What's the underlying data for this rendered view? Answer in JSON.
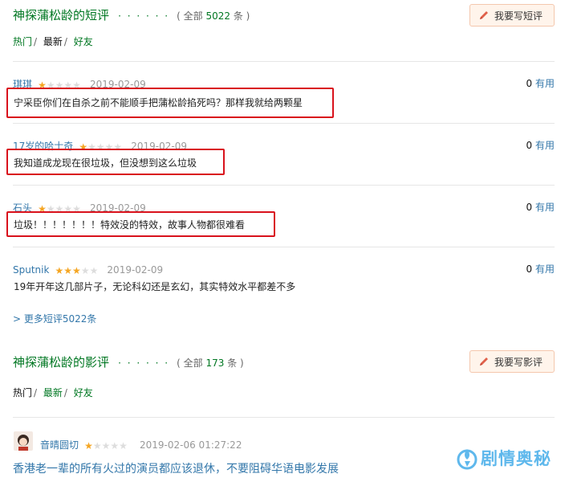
{
  "short_reviews": {
    "title": "神探蒲松龄的短评",
    "dots": "· · · · · ·",
    "count_prefix": "( 全部 ",
    "count": "5022",
    "count_suffix": " 条 )",
    "write_button": "我要写短评",
    "tabs": [
      "热门",
      "最新",
      "好友"
    ],
    "reviews": [
      {
        "user": "琪琪",
        "rating": 1,
        "date": "2019-02-09",
        "votes": "0",
        "votes_label": "有用",
        "text": "宁采臣你们在自杀之前不能顺手把蒲松龄掐死吗？那样我就给两颗星"
      },
      {
        "user": "17岁的哈士奇",
        "rating": 1,
        "date": "2019-02-09",
        "votes": "0",
        "votes_label": "有用",
        "text": "我知道成龙现在很垃圾，但没想到这么垃圾"
      },
      {
        "user": "石头",
        "rating": 1,
        "date": "2019-02-09",
        "votes": "0",
        "votes_label": "有用",
        "text": "垃圾！！！！！！！特效没的特效，故事人物都很难看"
      },
      {
        "user": "Sputnik",
        "rating": 3,
        "date": "2019-02-09",
        "votes": "0",
        "votes_label": "有用",
        "text": "19年开年这几部片子，无论科幻还是玄幻，其实特效水平都差不多"
      }
    ],
    "more_link": "> 更多短评5022条"
  },
  "film_reviews": {
    "title": "神探蒲松龄的影评",
    "dots": "· · · · · ·",
    "count_prefix": "( 全部 ",
    "count": "173",
    "count_suffix": " 条 )",
    "write_button": "我要写影评",
    "tabs": [
      "热门",
      "最新",
      "好友"
    ],
    "review": {
      "user": "音晴圆切",
      "rating": 1,
      "datetime": "2019-02-06 01:27:22",
      "title": "香港老一辈的所有火过的演员都应该退休，不要阻碍华语电影发展"
    }
  },
  "watermark": {
    "text": "剧情奥秘"
  },
  "colors": {
    "green": "#007722",
    "link_blue": "#3377aa",
    "star": "#f5a623",
    "highlight_box": "#d9121c"
  }
}
